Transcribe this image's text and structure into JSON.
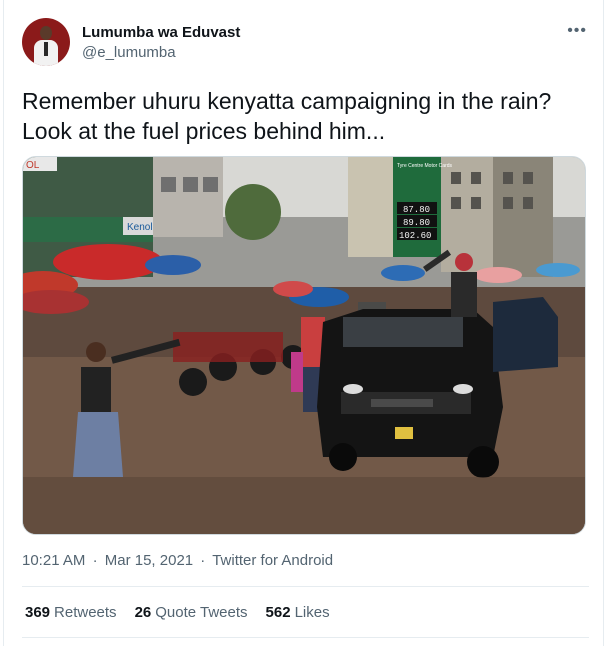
{
  "author": {
    "name": "Lumumba wa Eduvast",
    "handle": "@e_lumumba"
  },
  "more_icon": "more-horizontal-icon",
  "tweet": {
    "line1": "Remember uhuru kenyatta campaigning in the rain?",
    "line2": "Look at the fuel prices behind him..."
  },
  "media": {
    "sign_brand": "Tyre Centre Motor Cards",
    "prices": [
      "87.80",
      "89.80",
      "102.60"
    ],
    "kenol_sign": "Kenol",
    "ol_sign": "OL"
  },
  "meta": {
    "time": "10:21 AM",
    "sep1": "·",
    "date": "Mar 15, 2021",
    "sep2": "·",
    "source": "Twitter for Android"
  },
  "stats": {
    "retweets_count": "369",
    "retweets_label": "Retweets",
    "quotes_count": "26",
    "quotes_label": "Quote Tweets",
    "likes_count": "562",
    "likes_label": "Likes"
  },
  "colors": {
    "text": "#0f1419",
    "secondary": "#536471",
    "border": "#e6ecf0"
  }
}
